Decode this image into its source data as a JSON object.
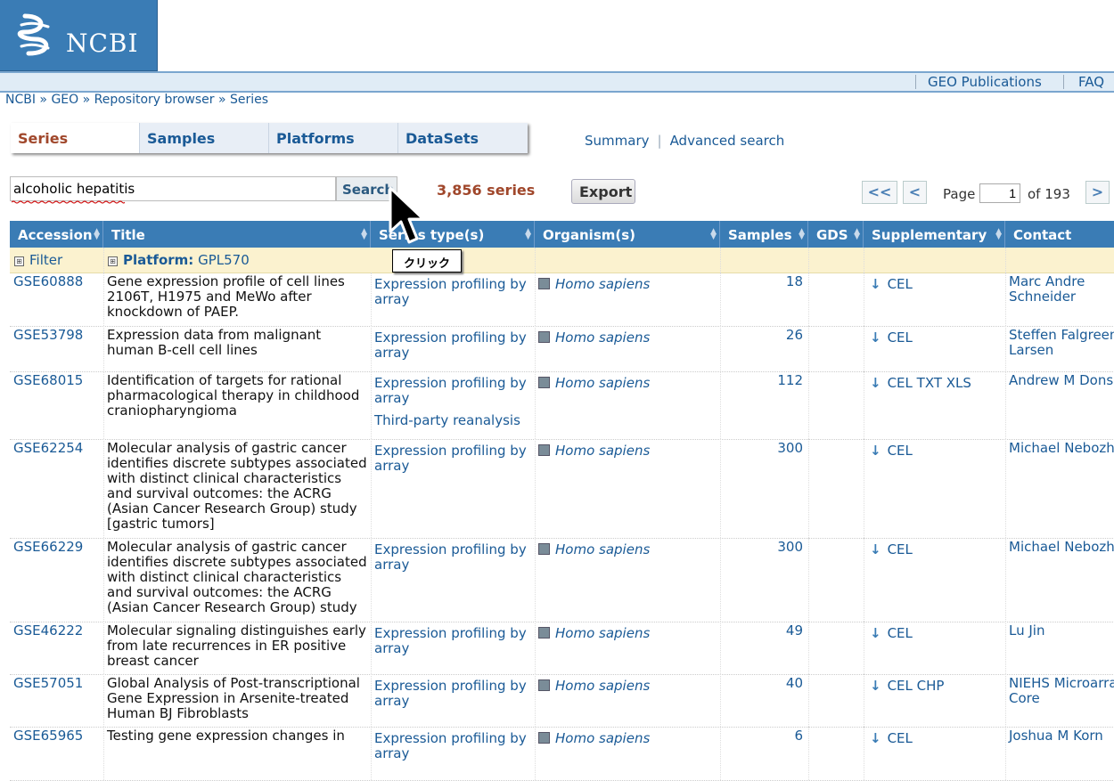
{
  "logo": {
    "text": "NCBI"
  },
  "topnav": {
    "links": [
      "GEO Publications",
      "FAQ"
    ]
  },
  "breadcrumb": "NCBI » GEO » Repository browser » Series",
  "tabs": [
    {
      "label": "Series",
      "active": true
    },
    {
      "label": "Samples"
    },
    {
      "label": "Platforms"
    },
    {
      "label": "DataSets"
    }
  ],
  "view_links": {
    "summary": "Summary",
    "separator": "|",
    "advanced": "Advanced search"
  },
  "search": {
    "value": "alcoholic hepatitis",
    "button": "Search"
  },
  "result_count": "3,856 series",
  "export_label": "Export",
  "pager": {
    "first": "<<",
    "prev": "<",
    "next": ">",
    "page_label": "Page",
    "page_value": "1",
    "of_label": "of 193"
  },
  "table": {
    "headers": [
      "Accession",
      "Title",
      "Series type(s)",
      "Organism(s)",
      "Samples",
      "GDS",
      "Supplementary",
      "Contact"
    ],
    "filter": {
      "label": "Filter",
      "platform_label": "Platform:",
      "platform_value": "GPL570"
    },
    "rows": [
      {
        "accession": "GSE60888",
        "title": "Gene expression profile of cell lines 2106T, H1975 and MeWo after knockdown of PAEP.",
        "type": "Expression profiling by array",
        "type_extra": "",
        "organism": "Homo sapiens",
        "samples": "18",
        "supp": "CEL",
        "contact": "Marc Andre Schneider"
      },
      {
        "accession": "GSE53798",
        "title": "Expression data from malignant human B-cell cell lines",
        "type": "Expression profiling by array",
        "type_extra": "",
        "organism": "Homo sapiens",
        "samples": "26",
        "supp": "CEL",
        "contact": "Steffen Falgreen Larsen"
      },
      {
        "accession": "GSE68015",
        "title": "Identification of targets for rational pharmacological therapy in childhood craniopharyngioma",
        "type": "Expression profiling by array",
        "type_extra": "Third-party reanalysis",
        "organism": "Homo sapiens",
        "samples": "112",
        "supp": "CEL TXT XLS",
        "contact": "Andrew M Donson"
      },
      {
        "accession": "GSE62254",
        "title": "Molecular analysis of gastric cancer identifies discrete subtypes associated with distinct clinical characteristics and survival outcomes: the ACRG (Asian Cancer Research Group) study [gastric tumors]",
        "type": "Expression profiling by array",
        "type_extra": "",
        "organism": "Homo sapiens",
        "samples": "300",
        "supp": "CEL",
        "contact": "Michael Nebozhyn"
      },
      {
        "accession": "GSE66229",
        "title": "Molecular analysis of gastric cancer identifies discrete subtypes associated with distinct clinical characteristics and survival outcomes: the ACRG (Asian Cancer Research Group) study",
        "type": "Expression profiling by array",
        "type_extra": "",
        "organism": "Homo sapiens",
        "samples": "300",
        "supp": "CEL",
        "contact": "Michael Nebozhyn"
      },
      {
        "accession": "GSE46222",
        "title": "Molecular signaling distinguishes early from late recurrences in ER positive breast cancer",
        "type": "Expression profiling by array",
        "type_extra": "",
        "organism": "Homo sapiens",
        "samples": "49",
        "supp": "CEL",
        "contact": "Lu Jin"
      },
      {
        "accession": "GSE57051",
        "title": "Global Analysis of Post-transcriptional Gene Expression in Arsenite-treated Human BJ Fibroblasts",
        "type": "Expression profiling by array",
        "type_extra": "",
        "organism": "Homo sapiens",
        "samples": "40",
        "supp": "CEL CHP",
        "contact": "NIEHS Microarray Core"
      },
      {
        "accession": "GSE65965",
        "title": "Testing gene expression changes in",
        "type": "Expression profiling by array",
        "type_extra": "",
        "organism": "Homo sapiens",
        "samples": "6",
        "supp": "CEL",
        "contact": "Joshua M Korn"
      }
    ]
  },
  "annotation": {
    "tooltip": "クリック"
  },
  "colors": {
    "header_blue": "#3a7cb5",
    "link": "#1a5a96",
    "accent": "#a0472b",
    "filter_bg": "#fbf2cf"
  }
}
